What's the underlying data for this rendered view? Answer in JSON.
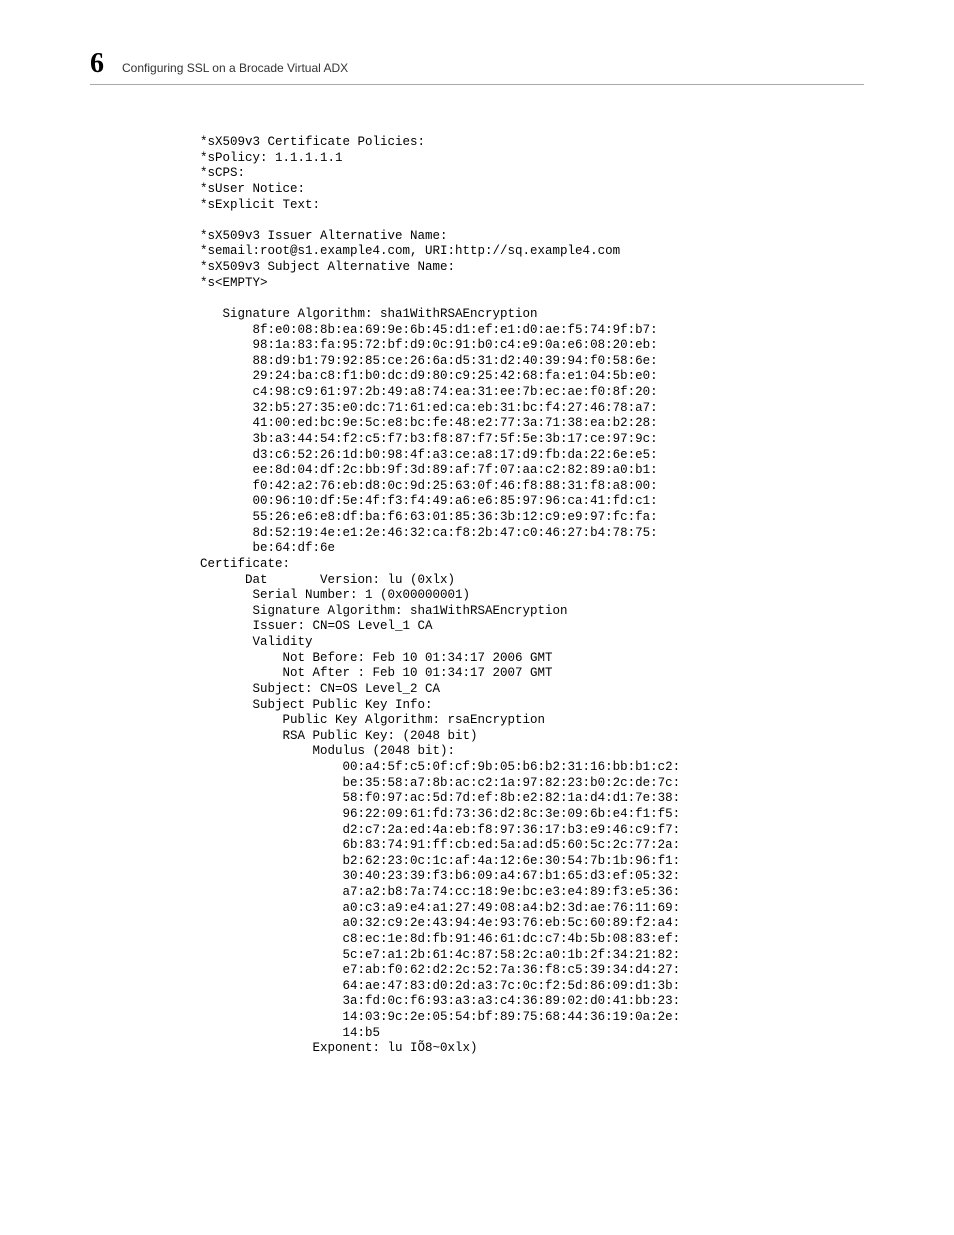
{
  "header": {
    "chapterNumber": "6",
    "chapterTitle": "Configuring SSL on a Brocade Virtual ADX"
  },
  "code": {
    "preamble": [
      "*sX509v3 Certificate Policies:",
      "*sPolicy: 1.1.1.1.1",
      "*sCPS:",
      "*sUser Notice:",
      "*sExplicit Text:",
      "",
      "*sX509v3 Issuer Alternative Name:",
      "*semail:root@s1.example4.com, URI:http://sq.example4.com",
      "*sX509v3 Subject Alternative Name:",
      "*s<EMPTY>",
      "",
      "   Signature Algorithm: sha1WithRSAEncryption"
    ],
    "sigHex": [
      "8f:e0:08:8b:ea:69:9e:6b:45:d1:ef:e1:d0:ae:f5:74:9f:b7:",
      "98:1a:83:fa:95:72:bf:d9:0c:91:b0:c4:e9:0a:e6:08:20:eb:",
      "88:d9:b1:79:92:85:ce:26:6a:d5:31:d2:40:39:94:f0:58:6e:",
      "29:24:ba:c8:f1:b0:dc:d9:80:c9:25:42:68:fa:e1:04:5b:e0:",
      "c4:98:c9:61:97:2b:49:a8:74:ea:31:ee:7b:ec:ae:f0:8f:20:",
      "32:b5:27:35:e0:dc:71:61:ed:ca:eb:31:bc:f4:27:46:78:a7:",
      "41:00:ed:bc:9e:5c:e8:bc:fe:48:e2:77:3a:71:38:ea:b2:28:",
      "3b:a3:44:54:f2:c5:f7:b3:f8:87:f7:5f:5e:3b:17:ce:97:9c:",
      "d3:c6:52:26:1d:b0:98:4f:a3:ce:a8:17:d9:fb:da:22:6e:e5:",
      "ee:8d:04:df:2c:bb:9f:3d:89:af:7f:07:aa:c2:82:89:a0:b1:",
      "f0:42:a2:76:eb:d8:0c:9d:25:63:0f:46:f8:88:31:f8:a8:00:",
      "00:96:10:df:5e:4f:f3:f4:49:a6:e6:85:97:96:ca:41:fd:c1:",
      "55:26:e6:e8:df:ba:f6:63:01:85:36:3b:12:c9:e9:97:fc:fa:",
      "8d:52:19:4e:e1:2e:46:32:ca:f8:2b:47:c0:46:27:b4:78:75:",
      "be:64:df:6e"
    ],
    "certBlock": [
      "Certificate:",
      "      Dat       Version: lu (0xlx)",
      "       Serial Number: 1 (0x00000001)",
      "       Signature Algorithm: sha1WithRSAEncryption",
      "       Issuer: CN=OS Level_1 CA",
      "       Validity",
      "           Not Before: Feb 10 01:34:17 2006 GMT",
      "           Not After : Feb 10 01:34:17 2007 GMT",
      "       Subject: CN=OS Level_2 CA",
      "       Subject Public Key Info:",
      "           Public Key Algorithm: rsaEncryption",
      "           RSA Public Key: (2048 bit)",
      "               Modulus (2048 bit):"
    ],
    "modHex": [
      "00:a4:5f:c5:0f:cf:9b:05:b6:b2:31:16:bb:b1:c2:",
      "be:35:58:a7:8b:ac:c2:1a:97:82:23:b0:2c:de:7c:",
      "58:f0:97:ac:5d:7d:ef:8b:e2:82:1a:d4:d1:7e:38:",
      "96:22:09:61:fd:73:36:d2:8c:3e:09:6b:e4:f1:f5:",
      "d2:c7:2a:ed:4a:eb:f8:97:36:17:b3:e9:46:c9:f7:",
      "6b:83:74:91:ff:cb:ed:5a:ad:d5:60:5c:2c:77:2a:",
      "b2:62:23:0c:1c:af:4a:12:6e:30:54:7b:1b:96:f1:",
      "30:40:23:39:f3:b6:09:a4:67:b1:65:d3:ef:05:32:",
      "a7:a2:b8:7a:74:cc:18:9e:bc:e3:e4:89:f3:e5:36:",
      "a0:c3:a9:e4:a1:27:49:08:a4:b2:3d:ae:76:11:69:",
      "a0:32:c9:2e:43:94:4e:93:76:eb:5c:60:89:f2:a4:",
      "c8:ec:1e:8d:fb:91:46:61:dc:c7:4b:5b:08:83:ef:",
      "5c:e7:a1:2b:61:4c:87:58:2c:a0:1b:2f:34:21:82:",
      "e7:ab:f0:62:d2:2c:52:7a:36:f8:c5:39:34:d4:27:",
      "64:ae:47:83:d0:2d:a3:7c:0c:f2:5d:86:09:d1:3b:",
      "3a:fd:0c:f6:93:a3:a3:c4:36:89:02:d0:41:bb:23:",
      "14:03:9c:2e:05:54:bf:89:75:68:44:36:19:0a:2e:",
      "14:b5"
    ],
    "exponentLine": "               Exponent: lu IÕ8~0xlx)"
  }
}
